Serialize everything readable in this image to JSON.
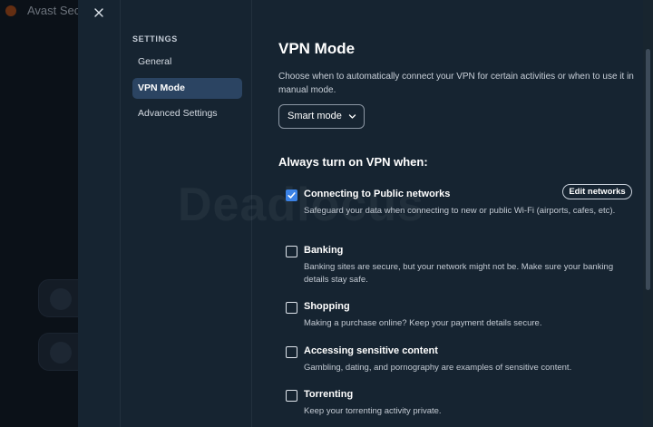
{
  "background_app": {
    "title": "Avast Secu"
  },
  "settings": {
    "heading": "SETTINGS",
    "nav": [
      {
        "label": "General"
      },
      {
        "label": "VPN Mode"
      },
      {
        "label": "Advanced Settings"
      }
    ]
  },
  "vpn_mode": {
    "title": "VPN Mode",
    "description": "Choose when to automatically connect your VPN for certain activities or when to use it in manual mode.",
    "mode_value": "Smart mode",
    "section_title": "Always turn on VPN when:",
    "edit_networks_label": "Edit networks",
    "options": [
      {
        "label": "Connecting to Public networks",
        "description": "Safeguard your data when connecting to new or public Wi-Fi (airports, cafes, etc).",
        "checked": true
      },
      {
        "label": "Banking",
        "description": "Banking sites are secure, but your network might not be. Make sure your banking details stay safe.",
        "checked": false
      },
      {
        "label": "Shopping",
        "description": "Making a purchase online? Keep your payment details secure.",
        "checked": false
      },
      {
        "label": "Accessing sensitive content",
        "description": "Gambling, dating, and pornography are examples of sensitive content.",
        "checked": false
      },
      {
        "label": "Torrenting",
        "description": "Keep your torrenting activity private.",
        "checked": false
      }
    ]
  },
  "watermark": "Deadlocus",
  "colors": {
    "panel_bg": "#162431",
    "accent": "#3b82e6",
    "nav_active": "#2b4462"
  }
}
